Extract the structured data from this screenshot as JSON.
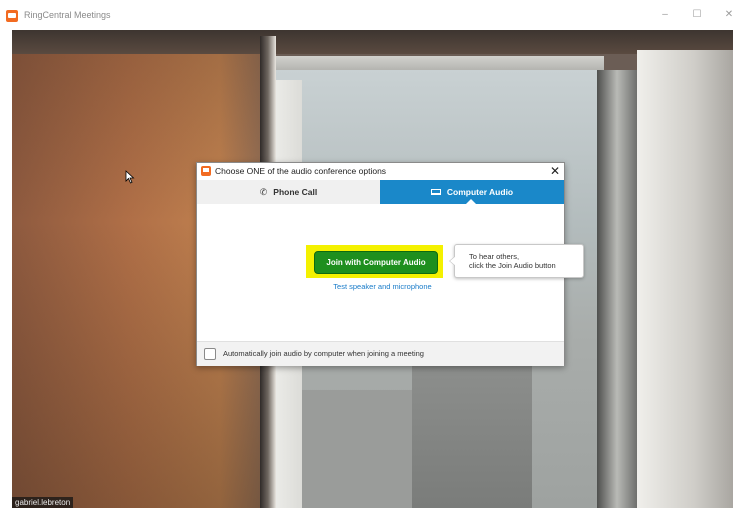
{
  "app": {
    "title": "RingCentral Meetings",
    "icon": "ringcentral-logo-icon"
  },
  "window_controls": {
    "minimize": "–",
    "maximize": "☐",
    "close": "✕"
  },
  "video": {
    "participant_name": "gabriel.lebreton"
  },
  "dialog": {
    "title": "Choose ONE of the audio conference options",
    "close": "✕",
    "tabs": [
      {
        "label": "Phone Call",
        "icon": "phone-icon",
        "selected": false
      },
      {
        "label": "Computer Audio",
        "icon": "laptop-icon",
        "selected": true
      }
    ],
    "join_button": "Join with Computer Audio",
    "test_link": "Test speaker and microphone",
    "auto_join_label": "Automatically join audio by computer when joining a meeting",
    "auto_join_checked": false
  },
  "tooltip": {
    "line1": "To hear others,",
    "line2": "click the Join Audio button"
  },
  "colors": {
    "accent": "#1a88c9",
    "join_button": "#1e8f1e",
    "highlight": "#f4f100",
    "brand": "#f26b21"
  }
}
